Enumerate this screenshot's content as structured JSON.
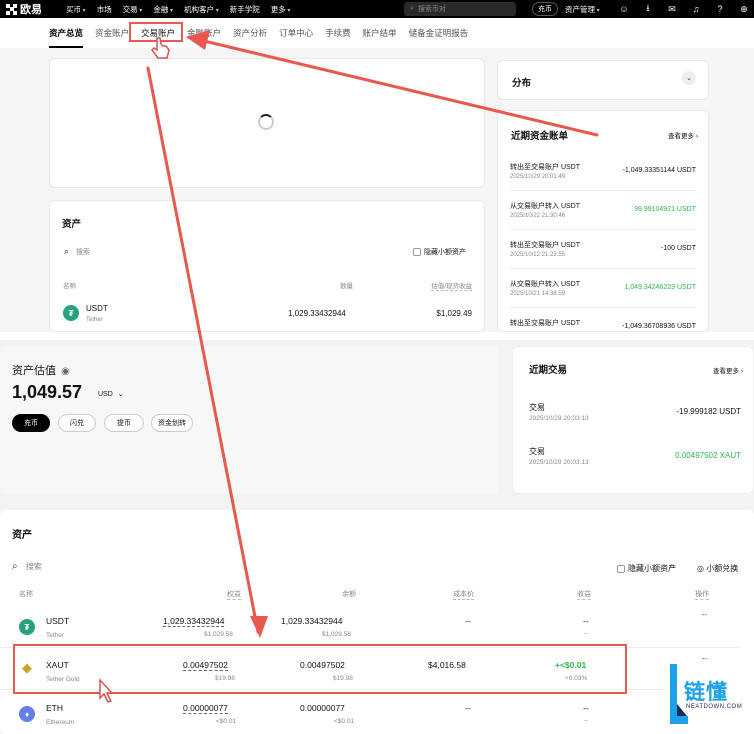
{
  "topbar": {
    "logo": "欧易",
    "nav": [
      "买币",
      "市场",
      "交易",
      "金融",
      "机构客户",
      "新手学院",
      "更多"
    ],
    "nav_has_caret": [
      true,
      false,
      true,
      true,
      true,
      false,
      true
    ],
    "search_placeholder": "搜索币对",
    "deposit": "充币",
    "asset_mgmt": "资产管理"
  },
  "subtabs": [
    "资产总览",
    "资金账户",
    "交易账户",
    "金融账户",
    "资产分析",
    "订单中心",
    "手续费",
    "账户结单",
    "储备金证明报告"
  ],
  "overview": {
    "distribution_title": "分布",
    "recent_ledger_title": "近期资金账单",
    "see_more": "查看更多",
    "ledger": [
      {
        "desc": "转出至交易账户 USDT",
        "time": "2025/10/29 20:01:49",
        "amount": "-1,049.33351144 USDT",
        "positive": false
      },
      {
        "desc": "从交易账户转入 USDT",
        "time": "2025/10/22 21:30:46",
        "amount": "99.99104921 USDT",
        "positive": true
      },
      {
        "desc": "转出至交易账户 USDT",
        "time": "2025/10/22 21:23:55",
        "amount": "-100 USDT",
        "positive": false
      },
      {
        "desc": "从交易账户转入 USDT",
        "time": "2025/10/21 14:38:59",
        "amount": "1,049.34246223 USDT",
        "positive": true
      },
      {
        "desc": "转出至交易账户 USDT",
        "time": "",
        "amount": "-1,049.36708936 USDT",
        "positive": false
      }
    ],
    "assets_title": "资产",
    "search_placeholder": "搜索",
    "hide_small": "隐藏小额资产",
    "col_name": "名称",
    "col_qty": "数量",
    "col_value": "估值/现货收益",
    "usdt_symbol": "USDT",
    "usdt_name": "Tether",
    "usdt_qty": "1,029.33432944",
    "usdt_value": "$1,029.49"
  },
  "trading": {
    "valuation_label": "资产估值",
    "valuation_amount": "1,049.57",
    "valuation_currency": "USD",
    "buttons": [
      "充币",
      "闪兑",
      "提币",
      "资金划转"
    ],
    "recent_title": "近期交易",
    "see_more": "查看更多",
    "trades": [
      {
        "type": "交易",
        "time": "2025/10/29 20:03:13",
        "amount": "-19.999182 USDT",
        "positive": false
      },
      {
        "type": "交易",
        "time": "2025/10/29 20:03:13",
        "amount": "0.00497502 XAUT",
        "positive": true
      }
    ],
    "assets_title": "资产",
    "search_placeholder": "搜索",
    "hide_small": "隐藏小额资产",
    "small_convert": "小额兑换",
    "columns": [
      "名称",
      "权益",
      "余额",
      "成本价",
      "收益",
      "操作"
    ],
    "rows": [
      {
        "symbol": "USDT",
        "name": "Tether",
        "equity": "1,029.33432944",
        "equity_usd": "$1,029.58",
        "balance": "1,029.33432944",
        "balance_usd": "$1,029.58",
        "cost": "--",
        "pnl": "--",
        "pnl_pct": "--",
        "ops": "--"
      },
      {
        "symbol": "XAUT",
        "name": "Tether Gold",
        "equity": "0.00497502",
        "equity_usd": "$19.98",
        "balance": "0.00497502",
        "balance_usd": "$19.98",
        "cost": "$4,016.58",
        "pnl": "+<$0.01",
        "pnl_pct": "+0.03%",
        "ops": "--"
      },
      {
        "symbol": "ETH",
        "name": "Ethereum",
        "equity": "0.00000077",
        "equity_usd": "<$0.01",
        "balance": "0.00000077",
        "balance_usd": "<$0.01",
        "cost": "--",
        "pnl": "--",
        "pnl_pct": "--",
        "ops": "--"
      }
    ]
  },
  "watermark": {
    "cn": "链懂",
    "en": "NEATDOWN.COM"
  },
  "colors": {
    "highlight": "#e8584f",
    "green": "#2eb84b",
    "usdt": "#26a17b",
    "eth": "#627eea",
    "gold": "#c9a227"
  }
}
